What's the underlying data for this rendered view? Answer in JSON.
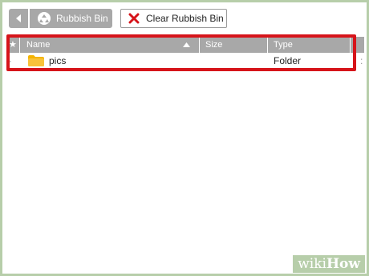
{
  "toolbar": {
    "location_label": "Rubbish Bin",
    "clear_label": "Clear Rubbish Bin"
  },
  "table": {
    "headers": {
      "star": "★",
      "name": "Name",
      "size": "Size",
      "type": "Type"
    },
    "rows": [
      {
        "bullet": "·",
        "name": "pics",
        "size": "",
        "type": "Folder",
        "extra": ":"
      }
    ]
  },
  "watermark": {
    "wiki": "wiki",
    "how": "How"
  },
  "colors": {
    "highlight": "#d6141a",
    "folder": "#f4b400",
    "clear_x": "#d6141a",
    "toolbar_gray": "#a8a8a8",
    "frame": "#b7ceaa"
  }
}
